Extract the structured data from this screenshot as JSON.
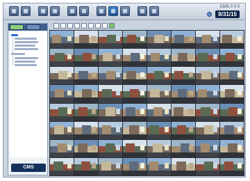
{
  "app": {
    "brand": "CMS",
    "brand_top": "CMS  0 0 0",
    "clock": "8/31/15"
  },
  "toolbar": {
    "buttons": [
      {
        "icon": "camera-icon"
      },
      {
        "icon": "record-icon"
      },
      {
        "icon": "layout-1-icon"
      },
      {
        "icon": "layout-4-icon"
      },
      {
        "icon": "layout-9-icon"
      },
      {
        "icon": "layout-16-icon"
      },
      {
        "icon": "person-icon"
      },
      {
        "icon": "grid-64-icon",
        "active": true
      },
      {
        "icon": "playback-icon"
      },
      {
        "icon": "settings-icon"
      },
      {
        "icon": "exit-icon"
      }
    ]
  },
  "sidebar": {
    "logo": "CMS"
  },
  "palette": {
    "sky": [
      "#8fb2d6",
      "#b7cbe0",
      "#6c8fb8",
      "#d7e2ec",
      "#9db6c9"
    ],
    "building": [
      "#7b6a5c",
      "#a38b6f",
      "#5d6b7c",
      "#c4b79a",
      "#8d4f3e",
      "#596b54"
    ],
    "road": [
      "#3e4248",
      "#5a5f66",
      "#2f3338",
      "#6d6a60"
    ],
    "window": [
      "#e6e2c4",
      "#f2f0de",
      "#c9d6e2",
      "#b9a88a"
    ]
  }
}
